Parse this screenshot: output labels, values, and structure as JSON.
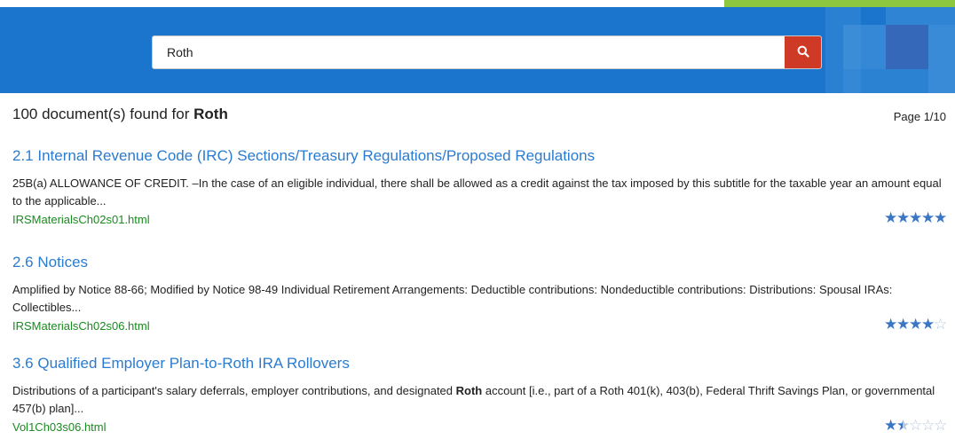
{
  "search": {
    "value": "Roth",
    "button_icon": "search-icon"
  },
  "summary": {
    "count_text": "100 document(s) found for ",
    "query": "Roth",
    "page": "Page 1/10"
  },
  "results": [
    {
      "title": "2.1 Internal Revenue Code (IRC) Sections/Treasury Regulations/Proposed Regulations",
      "snippet": "25B(a) ALLOWANCE OF CREDIT. –In the case of an eligible individual, there shall be allowed as a credit against the tax imposed by this subtitle for the taxable year an amount equal to the applicable...",
      "url": "IRSMaterialsCh02s01.html",
      "rating": 5
    },
    {
      "title": "2.6 Notices",
      "snippet": "Amplified by Notice 88-66; Modified by Notice 98-49 Individual Retirement Arrangements: Deductible contributions: Nondeductible contributions: Distributions: Spousal IRAs: Collectibles...",
      "url": "IRSMaterialsCh02s06.html",
      "rating": 4
    },
    {
      "title": "3.6 Qualified Employer Plan-to-Roth IRA Rollovers",
      "snippet_before": "Distributions of a participant's salary deferrals, employer contributions, and designated ",
      "snippet_bold": "Roth",
      "snippet_after": " account [i.e., part of a Roth 401(k), 403(b), Federal Thrift Savings Plan, or governmental 457(b) plan]...",
      "url": "Vol1Ch03s06.html",
      "rating": 1.5
    }
  ],
  "colors": {
    "header_blue": "#1b75cd",
    "search_red": "#cf3a27",
    "link_blue": "#2b7bd0",
    "url_green": "#1a8a20",
    "star_blue": "#3b76c4",
    "accent_green": "#8dc63f"
  }
}
